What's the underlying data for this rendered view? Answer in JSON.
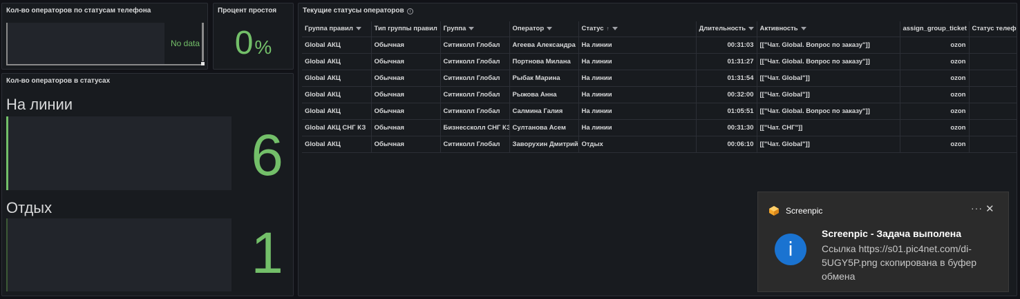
{
  "panels": {
    "phone_status": {
      "title": "Кол-во операторов по статусам телефона",
      "no_data": "No data"
    },
    "idle_percent": {
      "title": "Процент простоя",
      "value": "0",
      "unit": "%"
    },
    "status_counts": {
      "title": "Кол-во операторов в статусах",
      "items": [
        {
          "label": "На линии",
          "value": "6"
        },
        {
          "label": "Отдых",
          "value": "1"
        }
      ]
    },
    "current_statuses": {
      "title": "Текущие статусы операторов",
      "info_icon": "i",
      "columns": [
        "Группа правил",
        "Тип группы правил",
        "Группа",
        "Оператор",
        "Статус",
        "Длительность",
        "Активность",
        "assign_group_ticket",
        "Статус телефона"
      ],
      "rows": [
        [
          "Global АКЦ",
          "Обычная",
          "Ситиколл Глобал",
          "Агеева Александра",
          "На линии",
          "00:31:03",
          "[[\"Чат. Global. Вопрос по заказу\"]]",
          "ozon",
          ""
        ],
        [
          "Global АКЦ",
          "Обычная",
          "Ситиколл Глобал",
          "Портнова Милана",
          "На линии",
          "01:31:27",
          "[[\"Чат. Global. Вопрос по заказу\"]]",
          "ozon",
          ""
        ],
        [
          "Global АКЦ",
          "Обычная",
          "Ситиколл Глобал",
          "Рыбак Марина",
          "На линии",
          "01:31:54",
          "[[\"Чат. Global\"]]",
          "ozon",
          ""
        ],
        [
          "Global АКЦ",
          "Обычная",
          "Ситиколл Глобал",
          "Рыжова Анна",
          "На линии",
          "00:32:00",
          "[[\"Чат. Global\"]]",
          "ozon",
          ""
        ],
        [
          "Global АКЦ",
          "Обычная",
          "Ситиколл Глобал",
          "Салмина Галия",
          "На линии",
          "01:05:51",
          "[[\"Чат. Global. Вопрос по заказу\"]]",
          "ozon",
          ""
        ],
        [
          "Global АКЦ СНГ КЗ",
          "Обычная",
          "Бизнессколл СНГ КЗ",
          "Султанова Асем",
          "На линии",
          "00:31:30",
          "[[\"Чат. СНГ\"]]",
          "ozon",
          ""
        ],
        [
          "Global АКЦ",
          "Обычная",
          "Ситиколл Глобал",
          "Заворухин Дмитрий",
          "Отдых",
          "00:06:10",
          "[[\"Чат. Global\"]]",
          "ozon",
          ""
        ]
      ]
    }
  },
  "toast": {
    "app_name": "Screenpic",
    "more_label": "···",
    "close_label": "✕",
    "icon_glyph": "i",
    "title": "Screenpic - Задача выполена",
    "body": "Ссылка https://s01.pic4net.com/di-5UGY5P.png скопирована в буфер обмена"
  },
  "colors": {
    "accent_green": "#73bf69",
    "toast_blue": "#1a73d1",
    "background": "#111217",
    "panel": "#181b1f"
  }
}
